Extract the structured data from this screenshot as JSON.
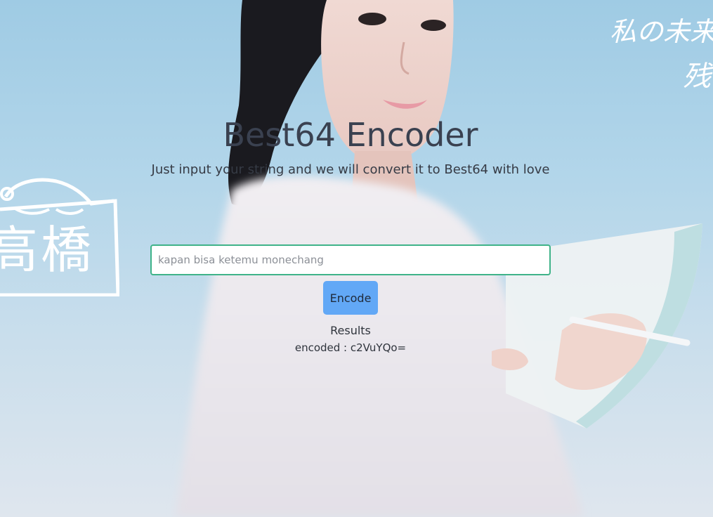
{
  "app": {
    "title": "Best64 Encoder",
    "subtitle": "Just input your string and we will convert it to Best64 with love"
  },
  "form": {
    "input_placeholder": "kapan bisa ketemu monechang",
    "input_value": "",
    "encode_label": "Encode"
  },
  "results": {
    "label": "Results",
    "prefix": "encoded : ",
    "value": "c2VuYQo="
  },
  "background": {
    "brand_text": "高橋",
    "handwriting_line_1": "私の未来",
    "handwriting_line_2": "残",
    "sky_color": "#a9d0e7"
  },
  "colors": {
    "input_border": "#3fb389",
    "button_bg": "#62a8f6",
    "title_text": "#3a4150"
  }
}
